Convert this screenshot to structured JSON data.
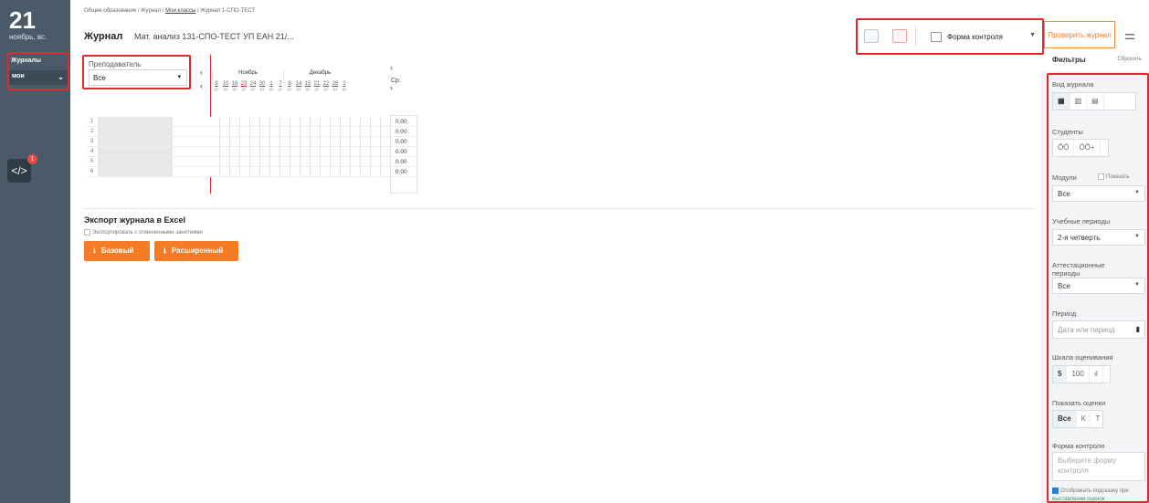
{
  "sidebar": {
    "date_day": "21",
    "date_sub": "ноябрь, вс.",
    "journals_label": "Журналы",
    "mine_value": "мои",
    "badge": "1",
    "code_icon": "</>"
  },
  "breadcrumb": {
    "part1": "Общее образование / Журнал / ",
    "link": "Мои классы",
    "part2": " / Журнал 1-СПО-ТЕСТ"
  },
  "header": {
    "title": "Журнал",
    "class_select": "Мат. анализ 131-СПО-ТЕСТ УП ЕАН 21/..."
  },
  "toolbar": {
    "control_form_label": "Форма контроля",
    "check_journal_label": "Проверить журнал",
    "pdf_label": "PDF"
  },
  "teacher": {
    "label": "Преподаватель",
    "value": "Все"
  },
  "grid": {
    "months": [
      "Ноябрь",
      "Декабрь"
    ],
    "days": [
      "9",
      "10",
      "16",
      "23",
      "24",
      "30",
      "1",
      "7",
      "8",
      "14",
      "15",
      "21",
      "22",
      "28",
      "2"
    ],
    "day_subs": [
      "ДЗ",
      "ДЗ",
      "ДЗ",
      "ДЗ",
      "ДЗ",
      "ДЗ",
      "ДЗ",
      "ДЗ",
      "ДЗ",
      "ДЗ",
      "ДЗ",
      "ДЗ",
      "ДЗ",
      "ДЗ",
      "ДЗ"
    ],
    "avg_header": "Ср.",
    "rows": [
      {
        "num": "1",
        "avg": "0.00"
      },
      {
        "num": "2",
        "avg": "0.00"
      },
      {
        "num": "3",
        "avg": "0.00"
      },
      {
        "num": "4",
        "avg": "0.00"
      },
      {
        "num": "5",
        "avg": "0.00"
      },
      {
        "num": "6",
        "avg": "0.00"
      }
    ]
  },
  "export": {
    "title": "Экспорт журнала в Excel",
    "checkbox_label": "Экспортировать с отмененными занятиями",
    "basic_button": "Базовый",
    "extended_button": "Расширенный"
  },
  "filters": {
    "title": "Фильтры",
    "reset": "Сбросить",
    "view_label": "Вид журнала",
    "students_label": "Студенты",
    "modules_label": "Модули",
    "modules_show": "Показать",
    "modules_value": "Все",
    "periods_label": "Учебные периоды",
    "periods_value": "2-я четверть",
    "attestation_label": "Аттестационные периоды",
    "attestation_value": "Все",
    "period_label": "Период",
    "period_placeholder": "Дата или период",
    "scale_label": "Шкала оценивания",
    "scale_options": [
      "5",
      "100"
    ],
    "show_grades_label": "Показать оценки",
    "show_grades_options": [
      "Все",
      "К",
      "Т"
    ],
    "control_form_label": "Форма контроля",
    "control_form_placeholder": "Выберите форму контроля",
    "hint_label": "Отображать подсказку при выставлении оценок"
  },
  "colors": {
    "accent": "#f57c24",
    "highlight": "#e0282e",
    "sidebar": "#4a5a68"
  }
}
